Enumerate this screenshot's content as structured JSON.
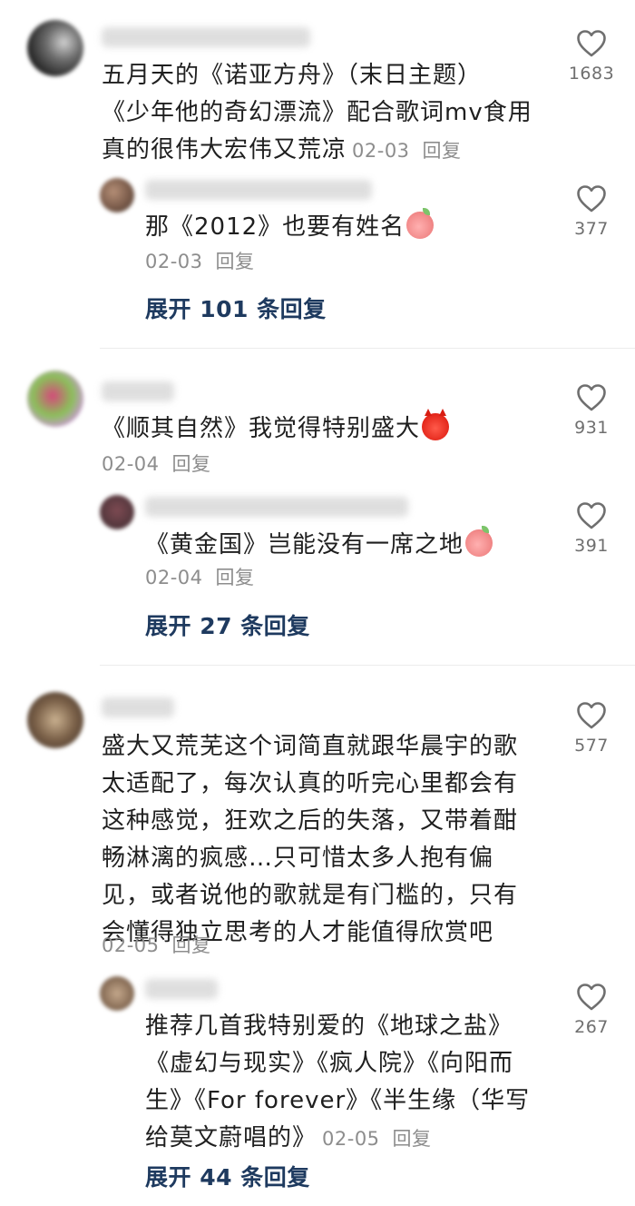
{
  "ui": {
    "reply_label": "回复",
    "heart_icon": "heart-outline-icon",
    "colors": {
      "text": "#1f1f1f",
      "meta": "#8d8d8d",
      "expand": "#1e3a5f",
      "divider": "#ececec"
    }
  },
  "threads": [
    {
      "comment": {
        "lines": [
          "五月天的《诺亚方舟》（末日主题）",
          "《少年他的奇幻漂流》配合歌词mv食用",
          "真的很伟大宏伟又荒凉"
        ],
        "date": "02-03",
        "likes": "1683"
      },
      "reply": {
        "lines": [
          "那《2012》也要有姓名"
        ],
        "emoji": "peach-emoji",
        "date": "02-03",
        "likes": "377"
      },
      "expand_label": "展开 101 条回复"
    },
    {
      "comment": {
        "lines": [
          "《顺其自然》我觉得特别盛大"
        ],
        "emoji": "devil-emoji",
        "date": "02-04",
        "likes": "931"
      },
      "reply": {
        "lines": [
          "《黄金国》岂能没有一席之地"
        ],
        "emoji": "peach-emoji",
        "date": "02-04",
        "likes": "391"
      },
      "expand_label": "展开 27 条回复"
    },
    {
      "comment": {
        "lines": [
          "盛大又荒芜这个词简直就跟华晨宇的歌",
          "太适配了，每次认真的听完心里都会有",
          "这种感觉，狂欢之后的失落，又带着酣",
          "畅淋漓的疯感…只可惜太多人抱有偏",
          "见，或者说他的歌就是有门槛的，只有",
          "会懂得独立思考的人才能值得欣赏吧"
        ],
        "date": "02-05",
        "likes": "577"
      },
      "reply": {
        "lines": [
          "推荐几首我特别爱的《地球之盐》",
          "《虚幻与现实》《疯人院》《向阳而",
          "生》《For forever》《半生缘（华写",
          "给莫文蔚唱的》"
        ],
        "date": "02-05",
        "likes": "267"
      },
      "expand_label": "展开 44 条回复"
    }
  ]
}
